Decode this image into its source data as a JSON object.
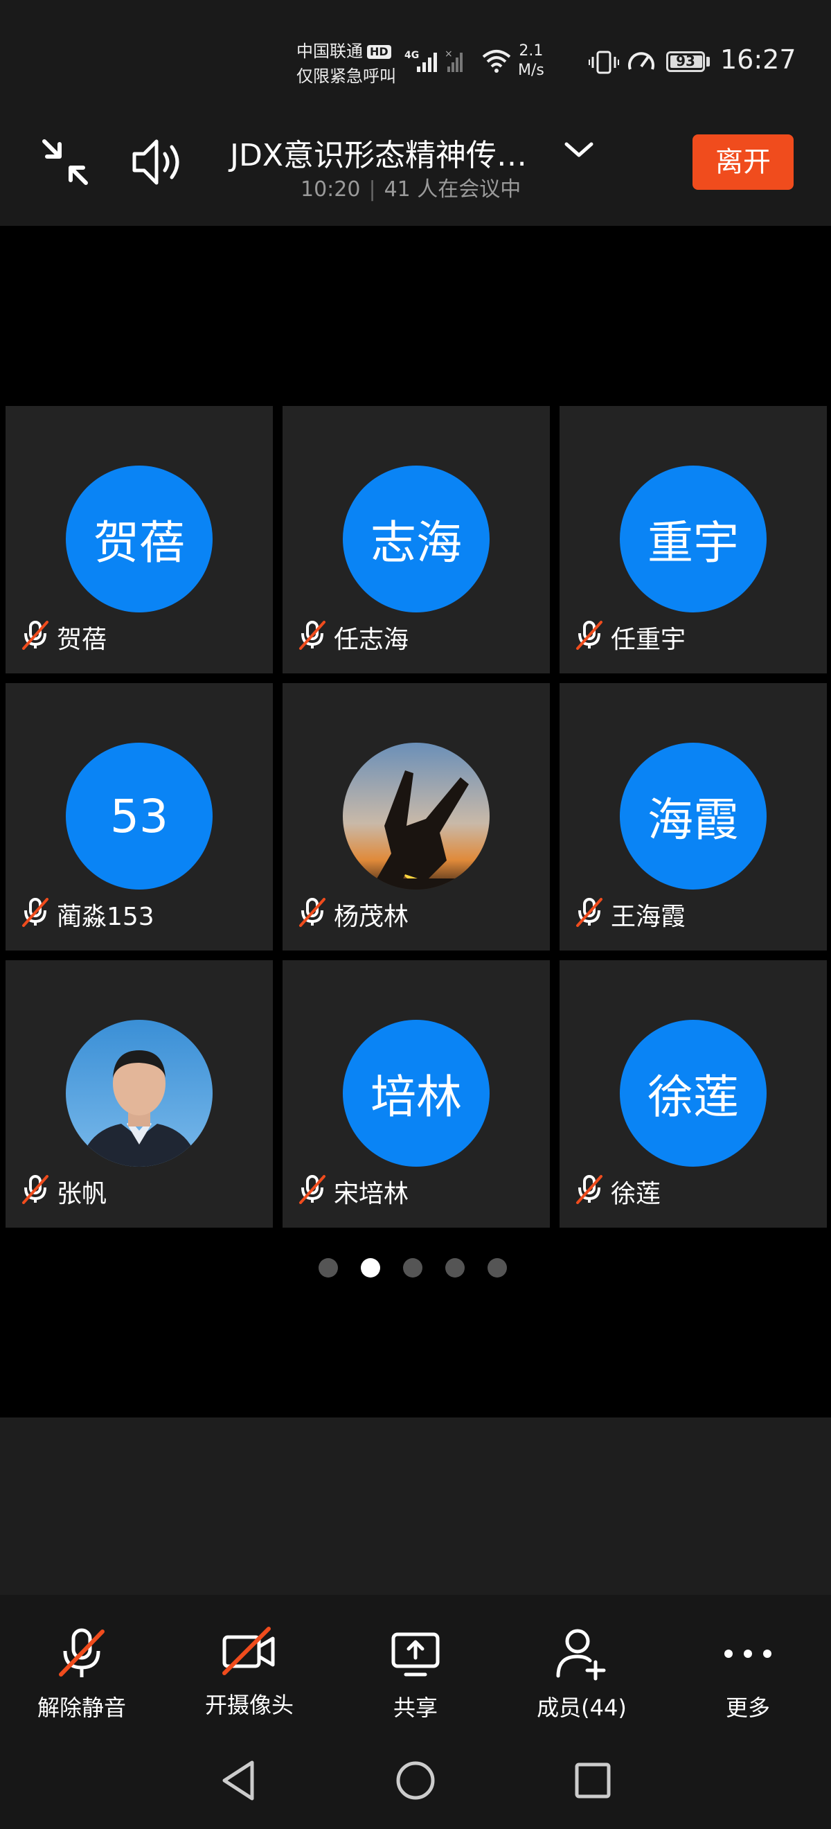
{
  "status_bar": {
    "carrier_line1": "中国联通",
    "hd_badge": "HD",
    "carrier_line2": "仅限紧急呼叫",
    "network_type": "4G",
    "speed_value": "2.1",
    "speed_unit": "M/s",
    "battery": "93",
    "time": "16:27"
  },
  "meeting": {
    "title": "JDX意识形态精神传…",
    "duration": "10:20",
    "participants_text": "41 人在会议中",
    "leave_label": "离开"
  },
  "participants": [
    {
      "avatar_text": "贺蓓",
      "name": "贺蓓",
      "avatar_type": "text"
    },
    {
      "avatar_text": "志海",
      "name": "任志海",
      "avatar_type": "text"
    },
    {
      "avatar_text": "重宇",
      "name": "任重宇",
      "avatar_type": "text"
    },
    {
      "avatar_text": "53",
      "name": "蔺淼153",
      "avatar_type": "text"
    },
    {
      "avatar_text": "",
      "name": "杨茂林",
      "avatar_type": "sunset-photo"
    },
    {
      "avatar_text": "海霞",
      "name": "王海霞",
      "avatar_type": "text"
    },
    {
      "avatar_text": "",
      "name": "张帆",
      "avatar_type": "portrait-photo"
    },
    {
      "avatar_text": "培林",
      "name": "宋培林",
      "avatar_type": "text"
    },
    {
      "avatar_text": "徐莲",
      "name": "徐莲",
      "avatar_type": "text"
    }
  ],
  "pagination": {
    "pages": 5,
    "active": 1
  },
  "toolbar": {
    "unmute": "解除静音",
    "camera": "开摄像头",
    "share": "共享",
    "members": "成员(44)",
    "more": "更多"
  },
  "colors": {
    "accent_blue": "#0a84f5",
    "leave_red": "#f04c1d",
    "muted_slash": "#f04c1d"
  }
}
